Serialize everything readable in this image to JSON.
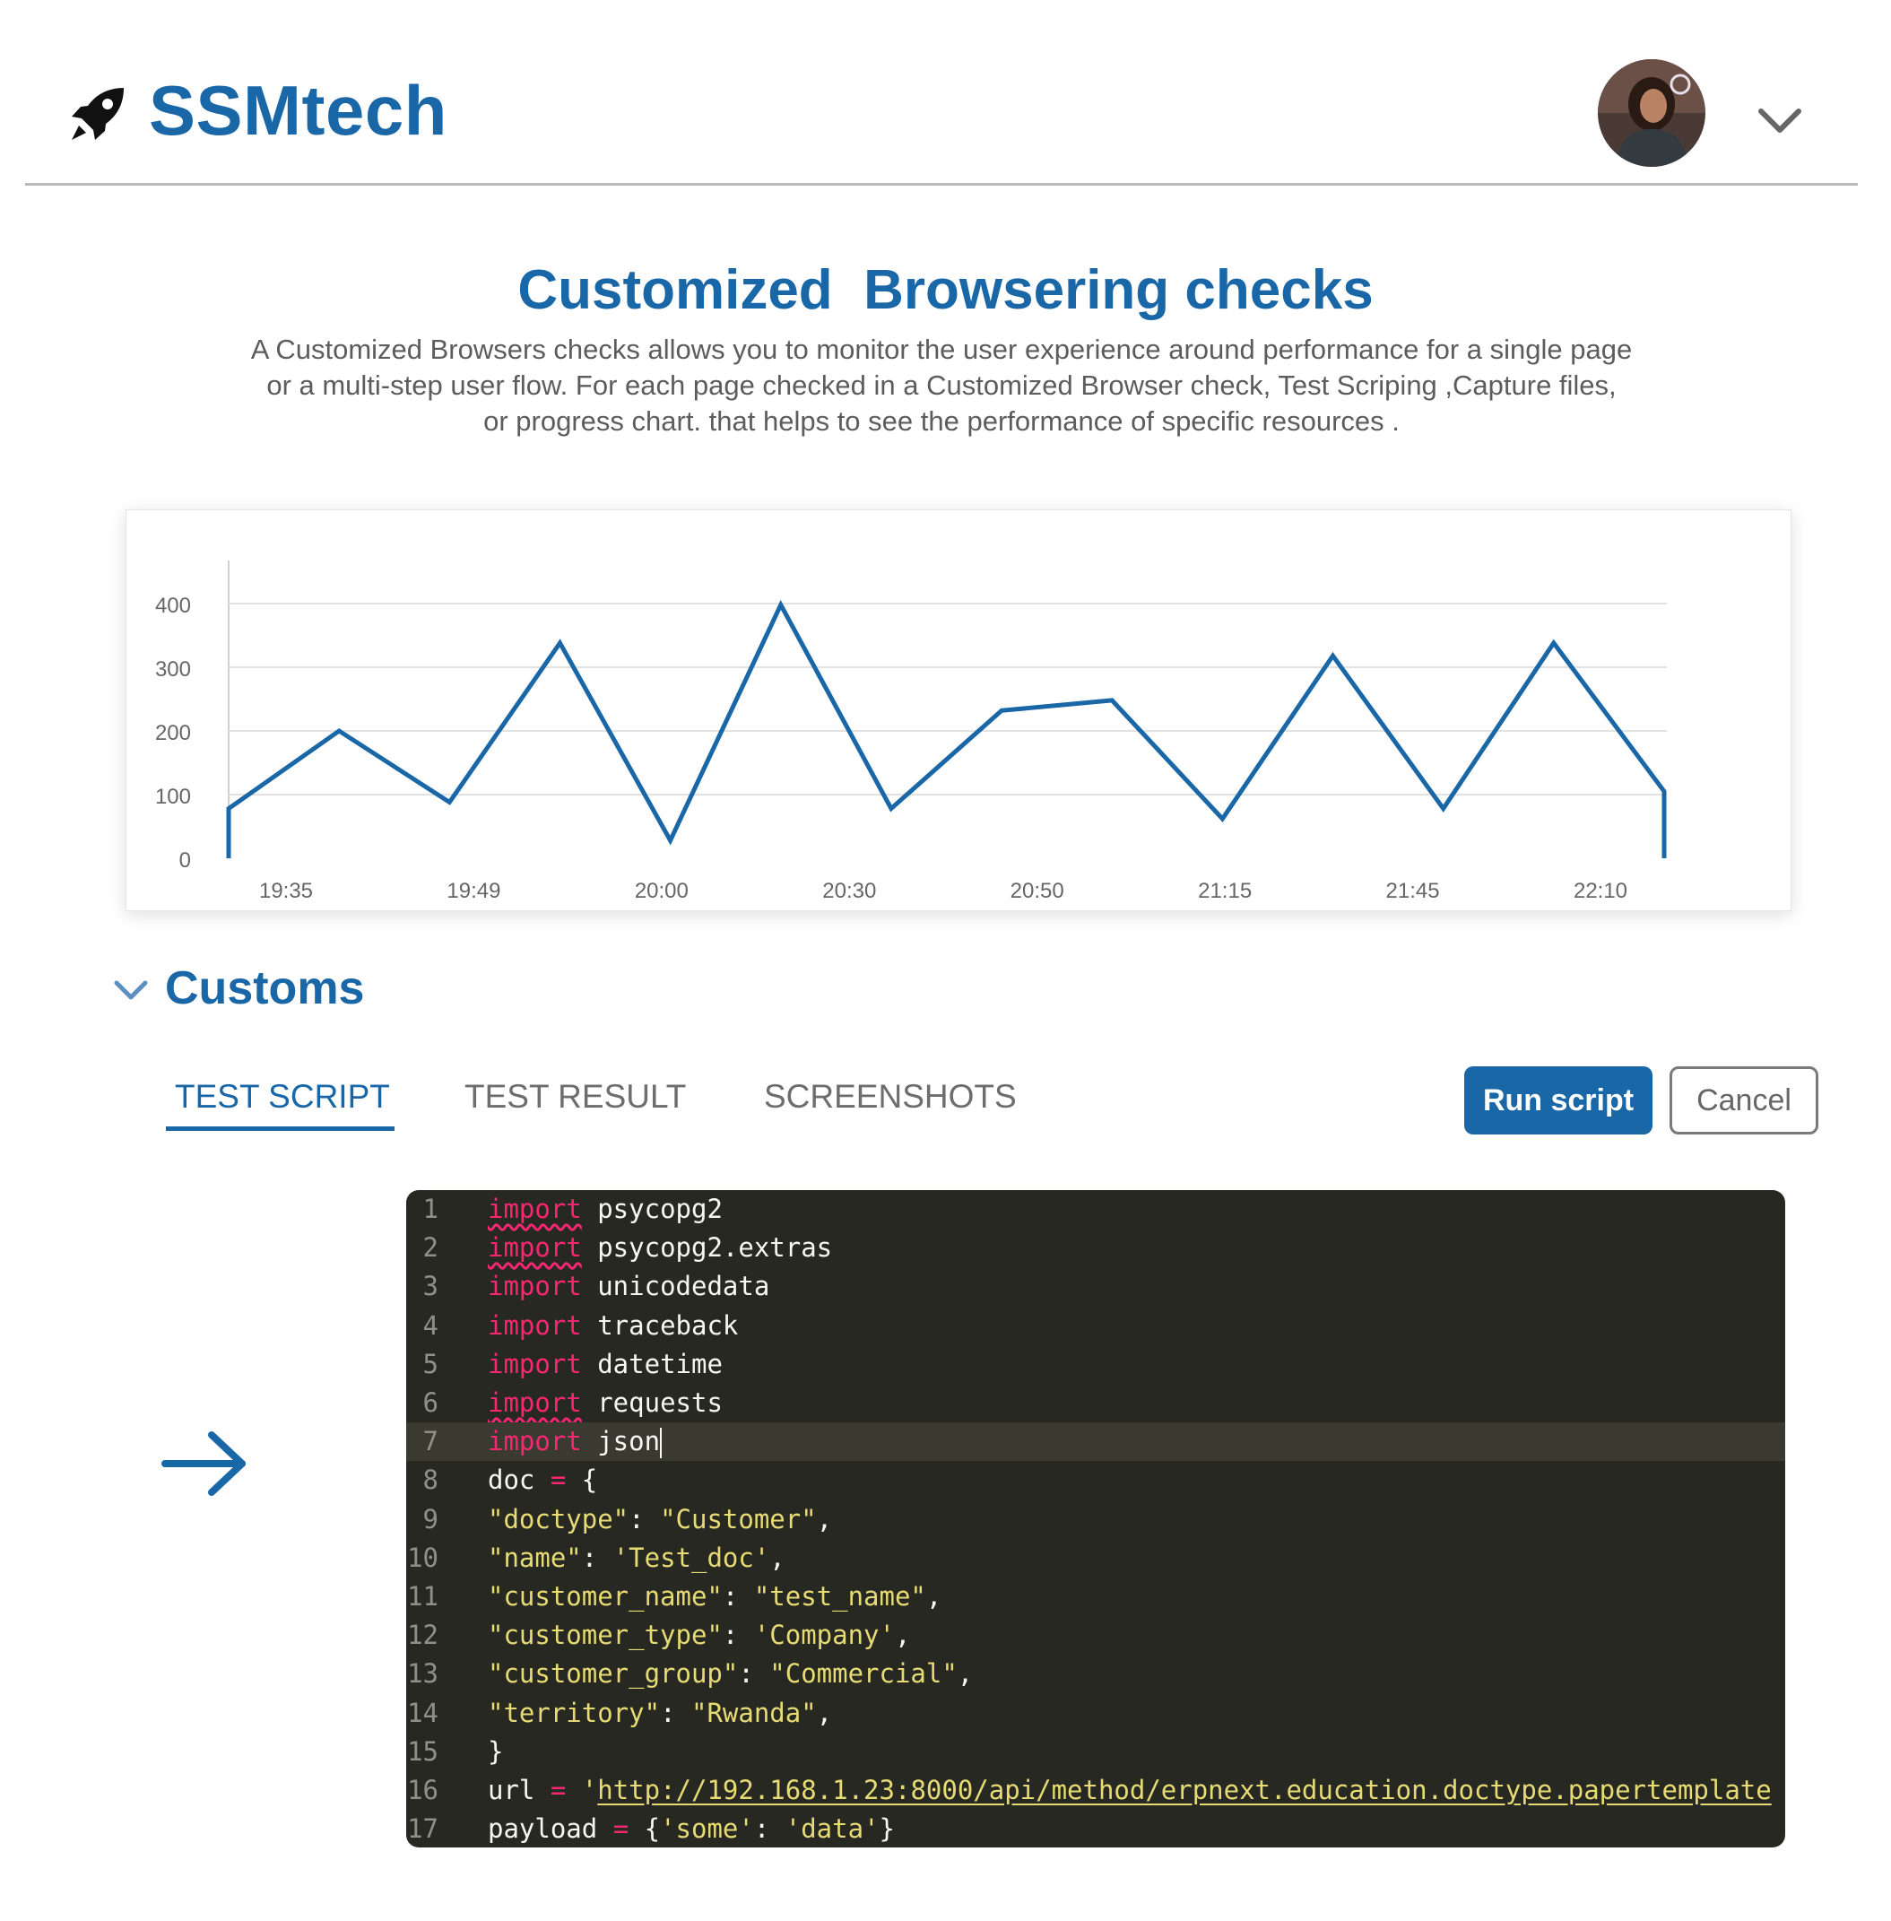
{
  "header": {
    "brand": "SSMtech",
    "logo_icon": "rocket-icon",
    "user_menu_icon": "chevron-down-icon"
  },
  "page": {
    "title": "Customized  Browsering checks",
    "description_lines": [
      "A Customized Browsers checks allows you to monitor the user experience around performance for a single page",
      "or a multi-step user flow. For each page checked in a Customized  Browser check, Test Scriping ,Capture files,",
      "or progress chart. that helps to see the performance of specific resources ."
    ]
  },
  "chart_data": {
    "type": "line",
    "title": "",
    "xlabel": "",
    "ylabel": "",
    "x_tick_labels": [
      "19:35",
      "19:49",
      "20:00",
      "20:30",
      "20:50",
      "21:15",
      "21:45",
      "22:10"
    ],
    "y_ticks": [
      0,
      100,
      200,
      300,
      400
    ],
    "ylim": [
      0,
      400
    ],
    "grid": true,
    "color": "#1a67a8",
    "series": [
      {
        "values": [
          78,
          200,
          88,
          338,
          28,
          398,
          78,
          232,
          248,
          62,
          318,
          78,
          338,
          105
        ]
      }
    ]
  },
  "customs": {
    "title": "Customs",
    "tabs": [
      {
        "label": "TEST SCRIPT",
        "active": true
      },
      {
        "label": "TEST RESULT",
        "active": false
      },
      {
        "label": "SCREENSHOTS",
        "active": false
      }
    ],
    "run_label": "Run script",
    "cancel_label": "Cancel",
    "pointer_icon": "arrow-right-icon"
  },
  "editor": {
    "current_line": 7,
    "lines": [
      {
        "n": "1",
        "tokens": [
          [
            "kw squiggle",
            "import"
          ],
          [
            "",
            " psycopg2"
          ]
        ]
      },
      {
        "n": "2",
        "tokens": [
          [
            "kw squiggle",
            "import"
          ],
          [
            "",
            " psycopg2.extras"
          ]
        ]
      },
      {
        "n": "3",
        "tokens": [
          [
            "kw",
            "import"
          ],
          [
            "",
            " unicodedata"
          ]
        ]
      },
      {
        "n": "4",
        "tokens": [
          [
            "kw",
            "import"
          ],
          [
            "",
            " traceback"
          ]
        ]
      },
      {
        "n": "5",
        "tokens": [
          [
            "kw",
            "import"
          ],
          [
            "",
            " datetime"
          ]
        ]
      },
      {
        "n": "6",
        "tokens": [
          [
            "kw squiggle",
            "import"
          ],
          [
            "",
            " requests"
          ]
        ]
      },
      {
        "n": "7",
        "tokens": [
          [
            "kw",
            "import"
          ],
          [
            "",
            " json"
          ]
        ]
      },
      {
        "n": "8",
        "tokens": [
          [
            "",
            "doc "
          ],
          [
            "op",
            "="
          ],
          [
            "",
            " {"
          ]
        ]
      },
      {
        "n": "9",
        "tokens": [
          [
            "str",
            "\"doctype\""
          ],
          [
            "",
            ": "
          ],
          [
            "str",
            "\"Customer\""
          ],
          [
            "",
            ","
          ]
        ]
      },
      {
        "n": "10",
        "tokens": [
          [
            "str",
            "\"name\""
          ],
          [
            "",
            ": "
          ],
          [
            "str",
            "'Test_doc'"
          ],
          [
            "",
            ","
          ]
        ]
      },
      {
        "n": "11",
        "tokens": [
          [
            "str",
            "\"customer_name\""
          ],
          [
            "",
            ": "
          ],
          [
            "str",
            "\"test_name\""
          ],
          [
            "",
            ","
          ]
        ]
      },
      {
        "n": "12",
        "tokens": [
          [
            "str",
            "\"customer_type\""
          ],
          [
            "",
            ": "
          ],
          [
            "str",
            "'Company'"
          ],
          [
            "",
            ","
          ]
        ]
      },
      {
        "n": "13",
        "tokens": [
          [
            "str",
            "\"customer_group\""
          ],
          [
            "",
            ": "
          ],
          [
            "str",
            "\"Commercial\""
          ],
          [
            "",
            ","
          ]
        ]
      },
      {
        "n": "14",
        "tokens": [
          [
            "str",
            "\"territory\""
          ],
          [
            "",
            ": "
          ],
          [
            "str",
            "\"Rwanda\""
          ],
          [
            "",
            ","
          ]
        ]
      },
      {
        "n": "15",
        "tokens": [
          [
            "",
            "}"
          ]
        ]
      },
      {
        "n": "16",
        "tokens": [
          [
            "",
            "url "
          ],
          [
            "op",
            "="
          ],
          [
            "",
            " "
          ],
          [
            "str",
            "'"
          ],
          [
            "str link",
            "http://192.168.1.23:8000/api/method/erpnext.education.doctype.papertemplate"
          ]
        ]
      },
      {
        "n": "17",
        "tokens": [
          [
            "",
            "payload "
          ],
          [
            "op",
            "="
          ],
          [
            "",
            " {"
          ],
          [
            "str",
            "'some'"
          ],
          [
            "",
            ": "
          ],
          [
            "str",
            "'data'"
          ],
          [
            "",
            "}"
          ]
        ]
      }
    ]
  }
}
